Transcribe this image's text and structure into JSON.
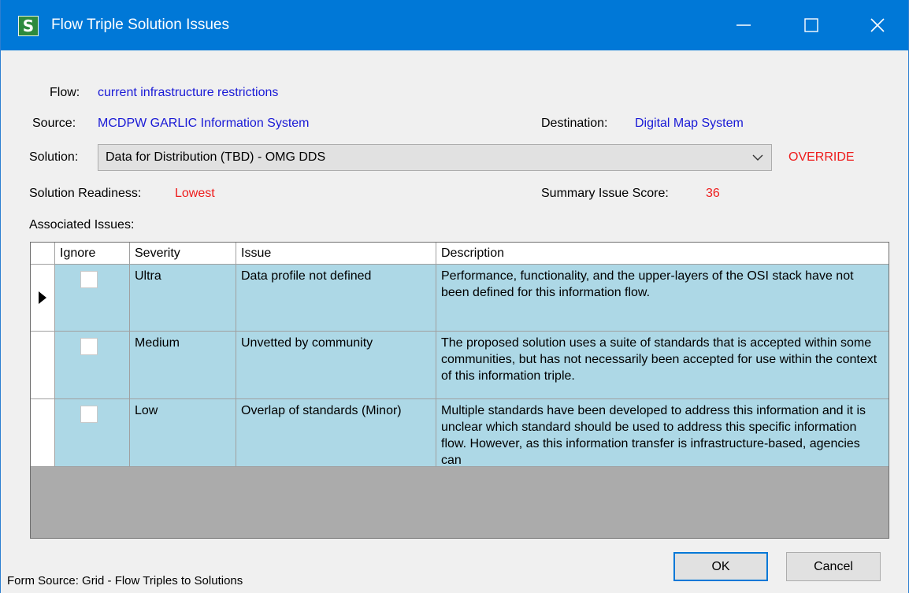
{
  "window": {
    "title": "Flow Triple Solution Issues",
    "icon_letter": "S"
  },
  "flow": {
    "label": "Flow:",
    "value": "current infrastructure restrictions"
  },
  "source": {
    "label": "Source:",
    "value": "MCDPW GARLIC Information System"
  },
  "destination": {
    "label": "Destination:",
    "value": "Digital Map System"
  },
  "solution": {
    "label": "Solution:",
    "selected": "Data for Distribution (TBD) - OMG DDS",
    "override": "OVERRIDE"
  },
  "readiness": {
    "label": "Solution Readiness:",
    "value": "Lowest"
  },
  "summary": {
    "label": "Summary Issue Score:",
    "value": "36"
  },
  "issues": {
    "label": "Associated Issues:",
    "columns": [
      "Ignore",
      "Severity",
      "Issue",
      "Description"
    ],
    "rows": [
      {
        "ignore": false,
        "severity": "Ultra",
        "issue": "Data profile not defined",
        "description": "Performance, functionality, and the upper-layers of the OSI stack have not been defined for this information flow."
      },
      {
        "ignore": false,
        "severity": "Medium",
        "issue": "Unvetted by community",
        "description": "The proposed solution uses a suite of standards that is accepted within some communities, but has not necessarily been accepted for use within the context of this information triple."
      },
      {
        "ignore": false,
        "severity": "Low",
        "issue": "Overlap of standards (Minor)",
        "description": "Multiple standards have been developed to address this information and it is unclear which standard should be used to address this specific information flow. However, as this information transfer is infrastructure-based, agencies can"
      }
    ]
  },
  "buttons": {
    "ok": "OK",
    "cancel": "Cancel"
  },
  "footer": {
    "form_source": "Form Source: Grid - Flow Triples to Solutions"
  },
  "colors": {
    "titlebar": "#0078d7",
    "link_blue": "#1a1ad6",
    "alert_red": "#ee1c1c",
    "row_bg": "#add8e6"
  }
}
